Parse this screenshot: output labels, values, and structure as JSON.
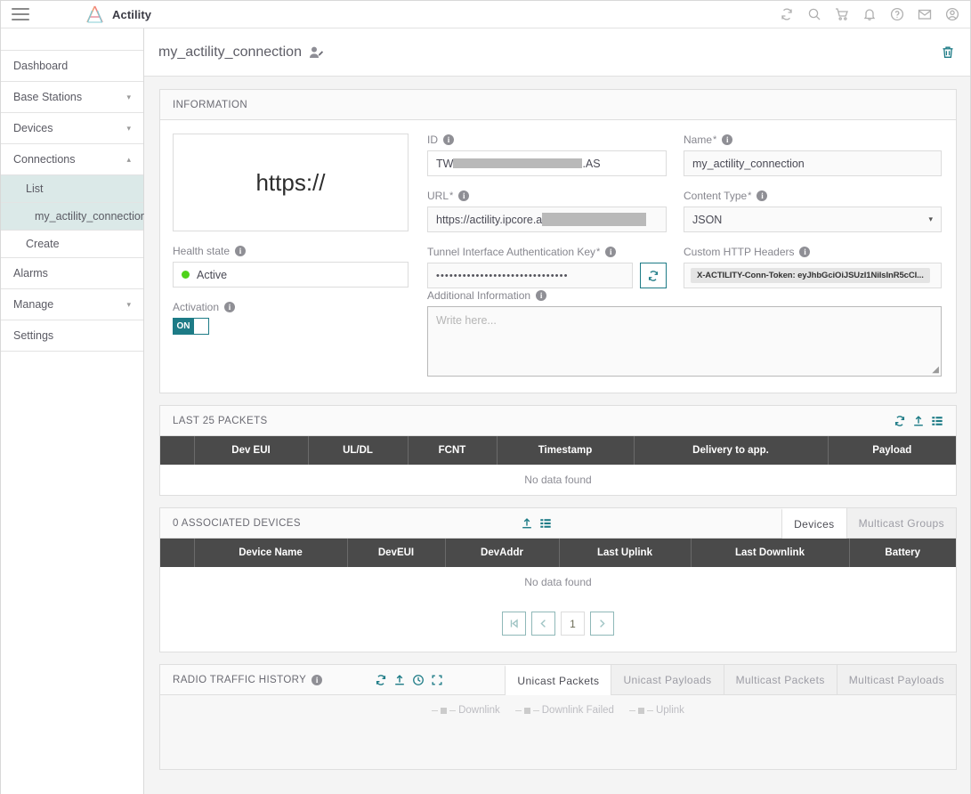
{
  "topbar": {
    "menu_icon": "hamburger-icon",
    "brand": "Actility",
    "icons": [
      "refresh-icon",
      "search-icon",
      "cart-icon",
      "bell-icon",
      "help-icon",
      "mail-icon",
      "account-icon"
    ]
  },
  "sidebar": {
    "items": [
      {
        "label": "Dashboard",
        "expandable": false
      },
      {
        "label": "Base Stations",
        "expandable": true,
        "caret": "⌄"
      },
      {
        "label": "Devices",
        "expandable": true,
        "caret": "⌄"
      },
      {
        "label": "Connections",
        "expandable": true,
        "caret": "⌃"
      }
    ],
    "sub_items": [
      {
        "label": "List",
        "selected": true
      },
      {
        "label": "my_actility_connection",
        "selected": true
      },
      {
        "label": "Create",
        "selected": false
      }
    ],
    "bottom_items": [
      {
        "label": "Alarms",
        "expandable": false
      },
      {
        "label": "Manage",
        "expandable": true,
        "caret": "⌄"
      },
      {
        "label": "Settings",
        "expandable": false
      }
    ]
  },
  "header": {
    "title": "my_actility_connection",
    "edit_icon": "user-edit-icon",
    "delete_icon": "trash-icon"
  },
  "information": {
    "section_title": "INFORMATION",
    "url_preview": "https://",
    "id": {
      "label": "ID",
      "value_prefix": "TW",
      "value_suffix": ".AS",
      "redacted": true
    },
    "url": {
      "label": "URL",
      "required": true,
      "value": "https://actility.ipcore.a",
      "redacted": true
    },
    "health_state": {
      "label": "Health state",
      "value": "Active",
      "status_color": "#4fd21a"
    },
    "activation": {
      "label": "Activation",
      "value": "ON",
      "enabled": true
    },
    "auth_key": {
      "label": "Tunnel Interface Authentication Key",
      "required": true,
      "value": "••••••••••••••••••••••••••••••",
      "refresh_icon": "refresh-icon"
    },
    "name": {
      "label": "Name",
      "required": true,
      "value": "my_actility_connection"
    },
    "content_type": {
      "label": "Content Type",
      "required": true,
      "value": "JSON",
      "options": [
        "JSON"
      ]
    },
    "custom_headers": {
      "label": "Custom HTTP Headers",
      "chip": "X-ACTILITY-Conn-Token: eyJhbGciOiJSUzI1NiIsInR5cCI..."
    },
    "additional_info": {
      "label": "Additional Information",
      "placeholder": "Write here...",
      "value": ""
    }
  },
  "packets": {
    "section_title": "LAST 25 PACKETS",
    "actions": [
      "refresh-icon",
      "export-icon",
      "columns-icon"
    ],
    "columns": [
      "",
      "Dev EUI",
      "UL/DL",
      "FCNT",
      "Timestamp",
      "Delivery to app.",
      "Payload"
    ],
    "empty_text": "No data found"
  },
  "devices": {
    "section_title": "0 ASSOCIATED DEVICES",
    "actions": [
      "export-icon",
      "columns-icon"
    ],
    "tabs": [
      {
        "label": "Devices",
        "active": true
      },
      {
        "label": "Multicast Groups",
        "active": false
      }
    ],
    "columns": [
      "",
      "Device Name",
      "DevEUI",
      "DevAddr",
      "Last Uplink",
      "Last Downlink",
      "Battery"
    ],
    "empty_text": "No data found",
    "pagination": {
      "first": "⏮",
      "prev": "‹",
      "page": "1",
      "next": "›"
    }
  },
  "radio_traffic": {
    "section_title": "RADIO TRAFFIC HISTORY",
    "actions": [
      "refresh-icon",
      "export-icon",
      "clock-icon",
      "fullscreen-icon"
    ],
    "tabs": [
      {
        "label": "Unicast Packets",
        "active": true
      },
      {
        "label": "Unicast Payloads",
        "active": false
      },
      {
        "label": "Multicast Packets",
        "active": false
      },
      {
        "label": "Multicast Payloads",
        "active": false
      }
    ],
    "legend": [
      "Downlink",
      "Downlink Failed",
      "Uplink"
    ]
  },
  "colors": {
    "accent": "#1d7b86",
    "selected_nav": "#dbe9e8",
    "table_header": "#4a4a4a",
    "status_active": "#4fd21a"
  }
}
